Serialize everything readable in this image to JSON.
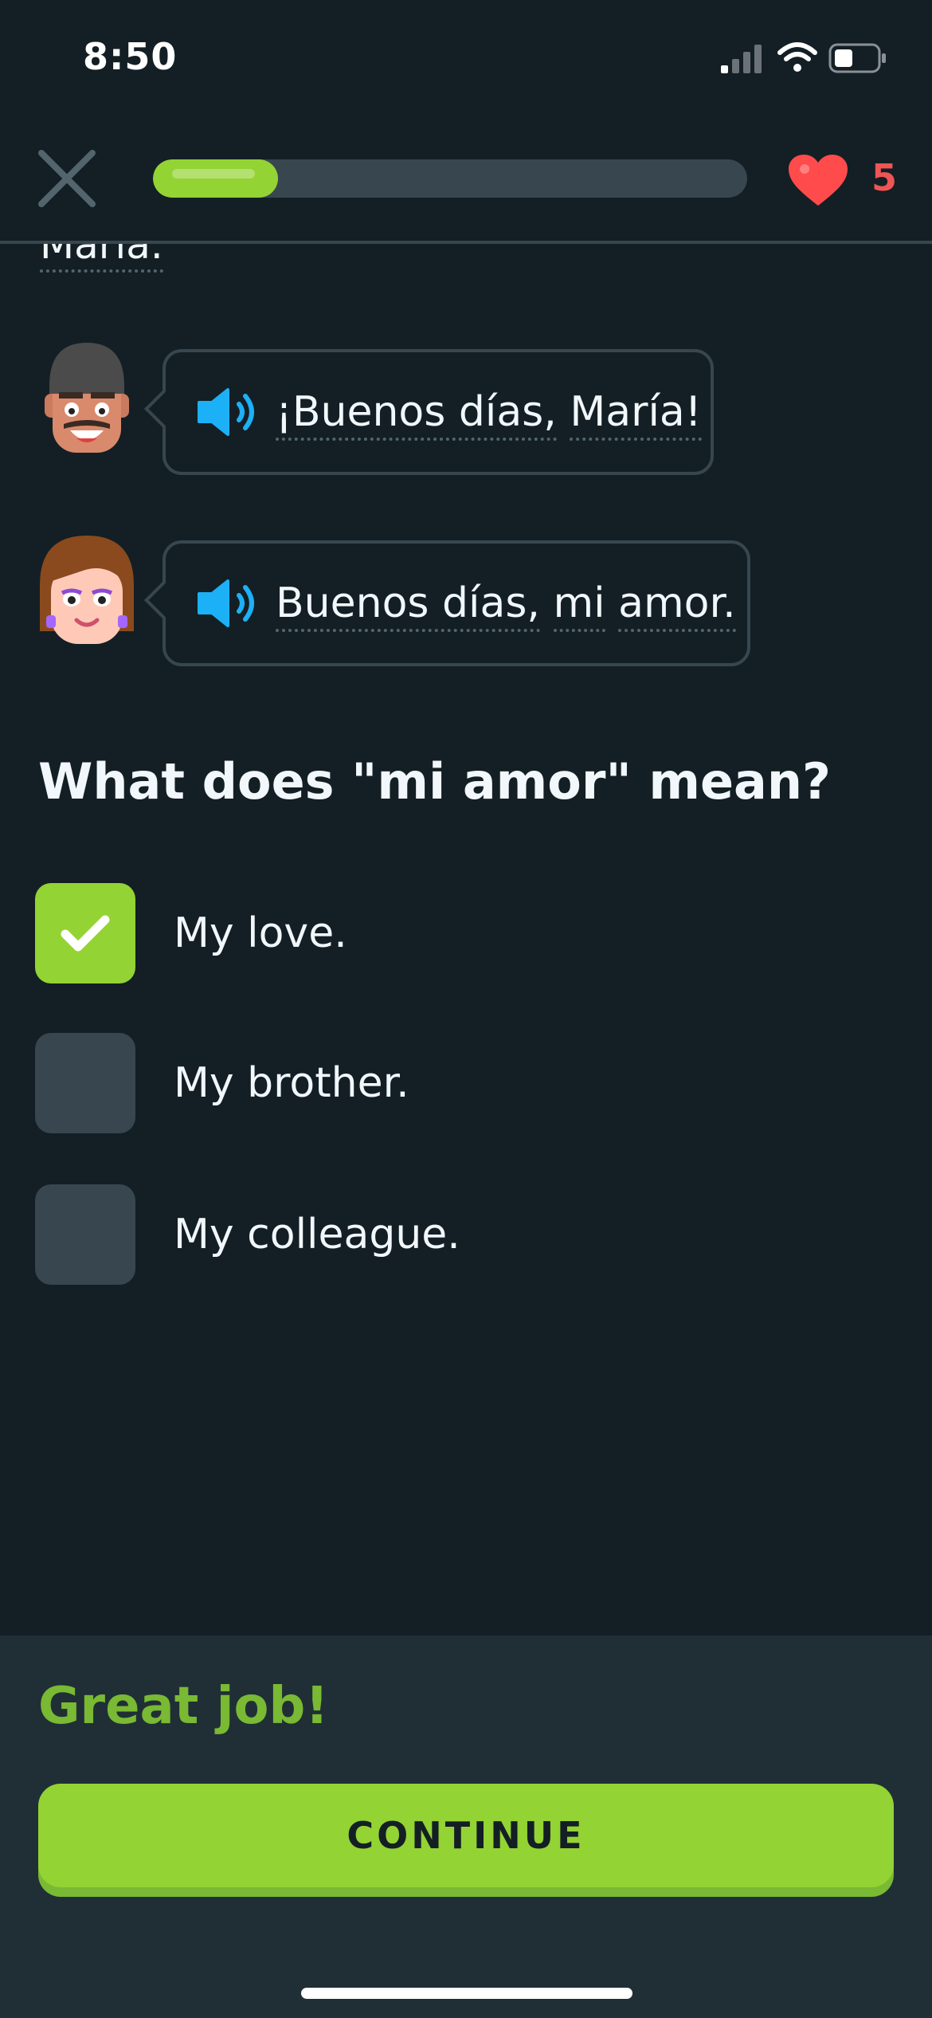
{
  "status_bar": {
    "time": "8:50"
  },
  "header": {
    "progress": 0.21,
    "hearts": "5"
  },
  "scrolled_text": "María.",
  "dialogue": [
    {
      "speaker": "man",
      "words": [
        "¡Buenos días,",
        "María!"
      ]
    },
    {
      "speaker": "woman",
      "words": [
        "Buenos días,",
        "mi",
        "amor."
      ]
    }
  ],
  "question": "What does \"mi amor\" mean?",
  "options": [
    {
      "label": "My love.",
      "checked": true
    },
    {
      "label": "My brother.",
      "checked": false
    },
    {
      "label": "My colleague.",
      "checked": false
    }
  ],
  "feedback": {
    "title": "Great job!",
    "button": "CONTINUE"
  },
  "colors": {
    "background": "#131f24",
    "accent_green": "#93d333",
    "feedback_green": "#79b933",
    "heart_red": "#ff4b4b",
    "speaker_blue": "#1cb0f6"
  },
  "icons": {
    "close": "close-icon",
    "heart": "heart-icon",
    "speaker": "speaker-icon",
    "check": "checkmark-icon"
  }
}
